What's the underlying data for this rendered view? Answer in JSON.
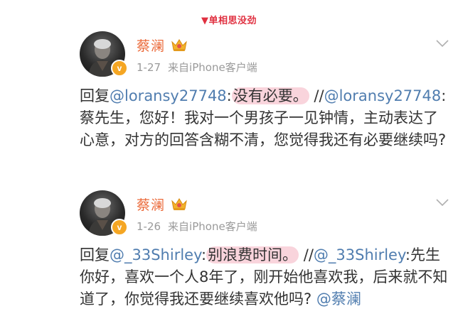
{
  "caption": "▼单相思没劲",
  "colors": {
    "name": "#eb6a3a",
    "mention": "#507daf",
    "caption": "#e03040",
    "highlight": "#f9d4dc",
    "badge": "#f5a623"
  },
  "posts": [
    {
      "author": "蔡澜",
      "date": "1-27",
      "source": "来自iPhone客户端",
      "badge": "v",
      "reply_prefix": "回复",
      "reply_to": "@loransy27748",
      "colon1": ":",
      "reply_text": "没有必要。",
      "separator": " //",
      "quoted_user": "@loransy27748",
      "colon2": ":",
      "quoted_text": "蔡先生，您好！我对一个男孩子一见钟情，主动表达了心意，对方的回答含糊不清，您觉得我还有必要继续吗?"
    },
    {
      "author": "蔡澜",
      "date": "1-26",
      "source": "来自iPhone客户端",
      "badge": "v",
      "reply_prefix": "回复",
      "reply_to": "@_33Shirley",
      "colon1": ":",
      "reply_text": "别浪费时间。",
      "separator": " //",
      "quoted_user": "@_33Shirley",
      "colon2": ":",
      "quoted_text": "先生你好，喜欢一个人8年了，刚开始他喜欢我，后来就不知道了，你觉得我还要继续喜欢他吗? ",
      "trailing_mention": "@蔡澜"
    }
  ]
}
